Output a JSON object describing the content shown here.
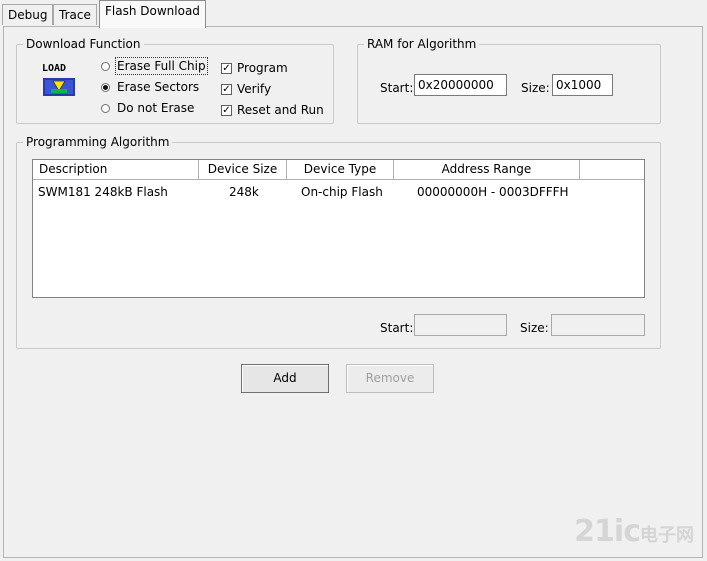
{
  "tabs": [
    {
      "label": "Debug"
    },
    {
      "label": "Trace"
    },
    {
      "label": "Flash Download"
    }
  ],
  "download_function": {
    "title": "Download Function",
    "icon": "load-icon",
    "icon_text": "LOAD",
    "options": [
      {
        "label": "Erase Full Chip",
        "selected": false
      },
      {
        "label": "Erase Sectors",
        "selected": true
      },
      {
        "label": "Do not Erase",
        "selected": false
      }
    ],
    "checks": [
      {
        "label": "Program",
        "checked": true
      },
      {
        "label": "Verify",
        "checked": true
      },
      {
        "label": "Reset and Run",
        "checked": true
      }
    ]
  },
  "ram": {
    "title": "RAM for Algorithm",
    "start_label": "Start:",
    "start_value": "0x20000000",
    "size_label": "Size:",
    "size_value": "0x1000"
  },
  "programming_algorithm": {
    "title": "Programming Algorithm",
    "columns": [
      "Description",
      "Device Size",
      "Device Type",
      "Address Range"
    ],
    "rows": [
      {
        "description": "SWM181 248kB Flash",
        "device_size": "248k",
        "device_type": "On-chip Flash",
        "address_range": "00000000H - 0003DFFFH"
      }
    ],
    "start_label": "Start:",
    "start_value": "",
    "size_label": "Size:",
    "size_value": ""
  },
  "buttons": {
    "add": "Add",
    "remove": "Remove"
  },
  "watermark": {
    "text": "21ic",
    "cn": "电子网"
  },
  "colors": {
    "background": "#f0f0f0",
    "disabled_text": "#a0a0a0"
  }
}
